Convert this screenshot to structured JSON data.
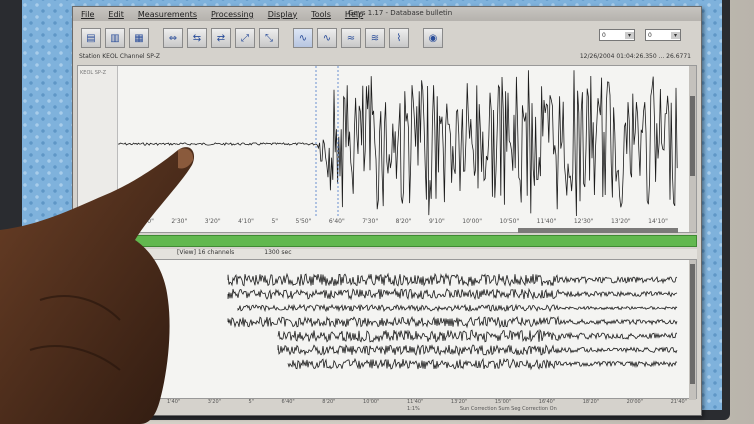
{
  "window": {
    "title": "Geys 1.17 - Database bulletin",
    "menus": [
      "File",
      "Edit",
      "Measurements",
      "Processing",
      "Display",
      "Tools",
      "Help"
    ]
  },
  "toolbar": {
    "buttons": [
      {
        "icon": "open-folder-icon"
      },
      {
        "icon": "folder-icon"
      },
      {
        "icon": "folder-icon"
      },
      {
        "icon": "zoom-icon"
      },
      {
        "icon": "zoom-icon"
      },
      {
        "icon": "zoom-icon"
      },
      {
        "icon": "zoom-icon"
      },
      {
        "icon": "zoom-icon"
      },
      {
        "icon": "waveform-icon"
      },
      {
        "icon": "waveform-icon"
      },
      {
        "icon": "waveform-icon"
      },
      {
        "icon": "waveform-icon"
      },
      {
        "icon": "waveform-icon"
      },
      {
        "icon": "globe-icon"
      }
    ],
    "spinner1": "0",
    "spinner2": "0"
  },
  "station": {
    "label": "Station KEOL Channel SP-Z",
    "timestamp": "12/26/2004 01:04:26.350 ... 26.6771"
  },
  "upper_panel": {
    "side_label": "KEOL SP-Z",
    "time_ticks": [
      "1'40\"",
      "2'30\"",
      "3'20\"",
      "4'10\"",
      "5\"",
      "5'50\"",
      "6'40\"",
      "7'30\"",
      "8'20\"",
      "9'10\"",
      "10'00\"",
      "10'50\"",
      "11'40\"",
      "12'30\"",
      "13'20\"",
      "14'10\""
    ]
  },
  "lower_panel": {
    "header": "[View] 16 channels",
    "header_right": "1300 sec",
    "time_ticks": [
      "1'40\"",
      "3'20\"",
      "5\"",
      "6'40\"",
      "8'20\"",
      "10'00\"",
      "11'40\"",
      "13'20\"",
      "15'00\"",
      "16'40\"",
      "18'20\"",
      "20'00\"",
      "21'40\""
    ]
  },
  "footer": {
    "zoom": "1:1%",
    "status": "Sun Correction  Sum Seg Correction On"
  },
  "colors": {
    "status_strip": "#62b84f",
    "desktop": "#7fb2dc",
    "wave": "#1b1b1b"
  }
}
